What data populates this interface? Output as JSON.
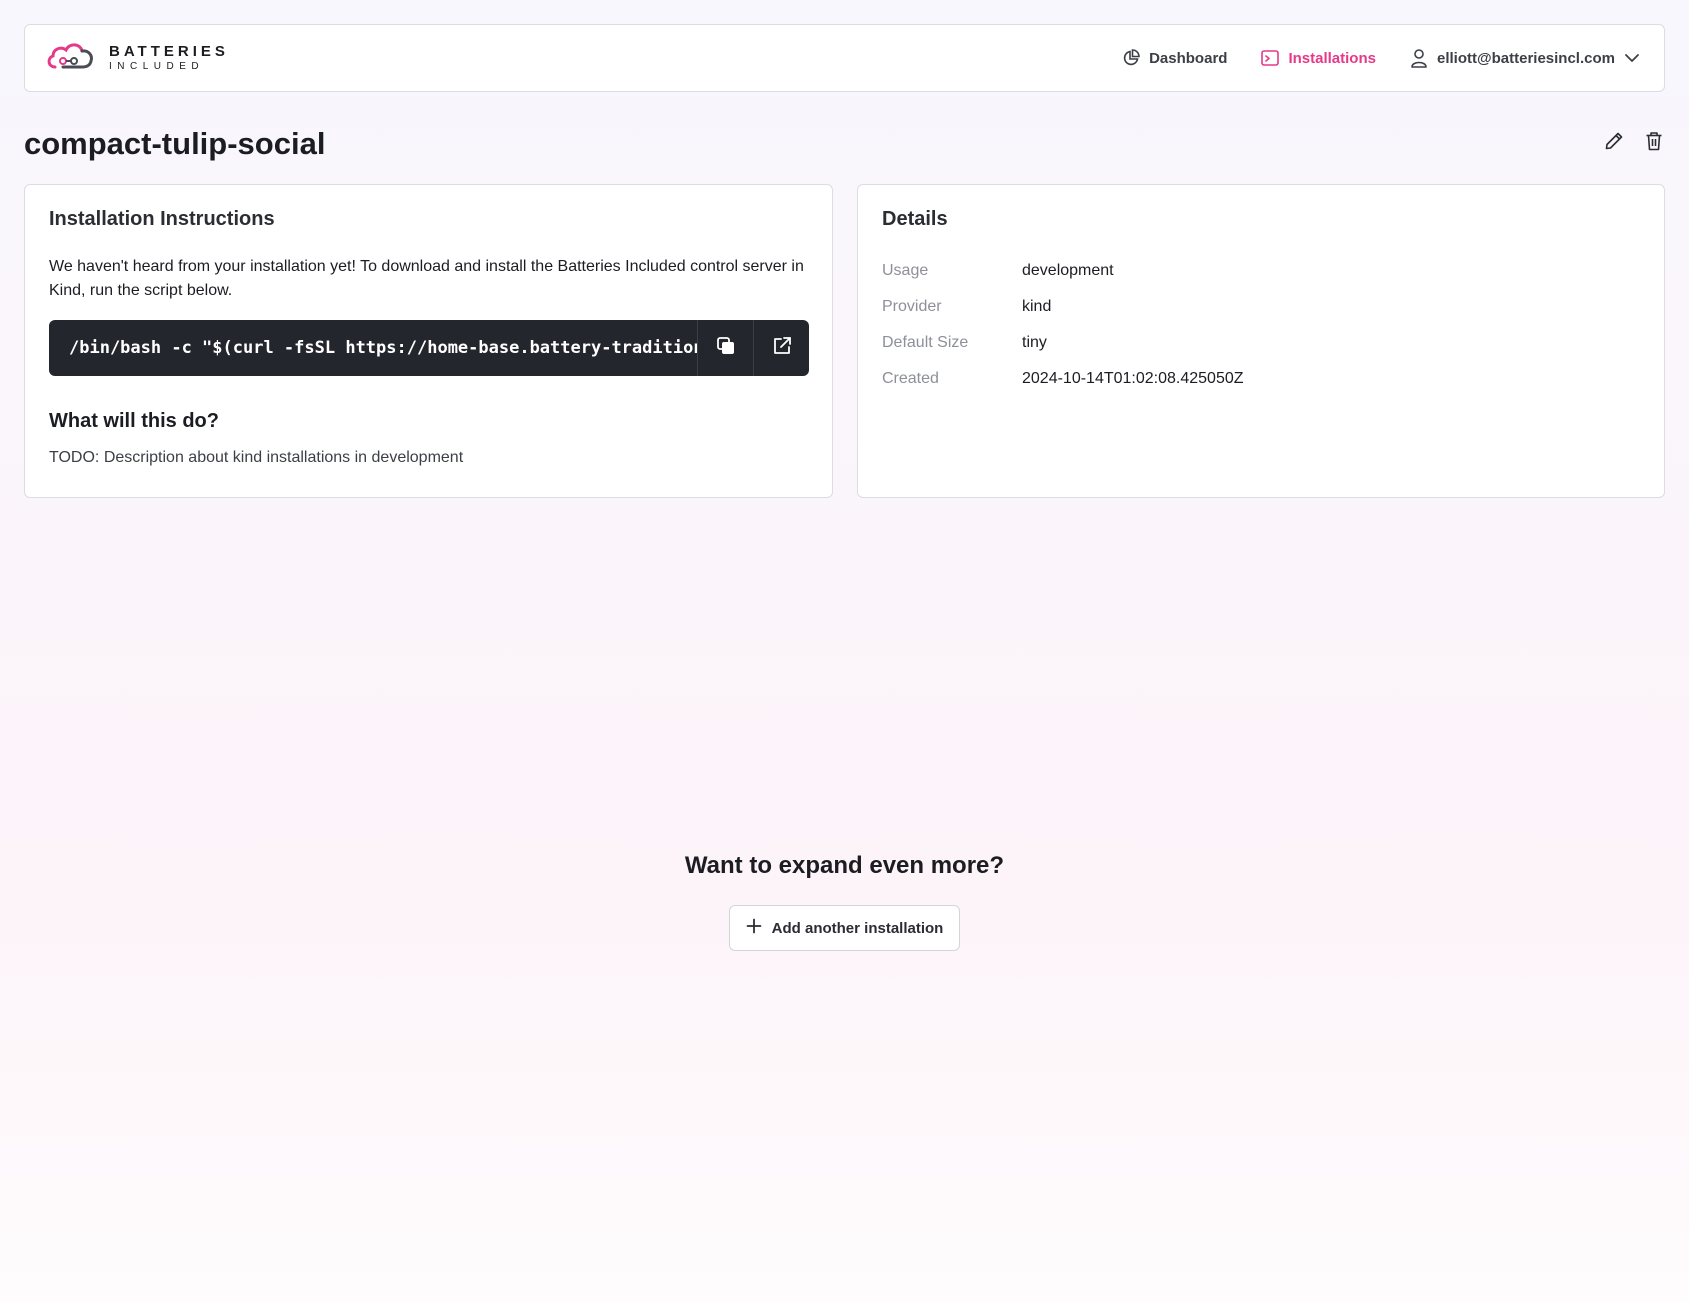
{
  "brand": {
    "line1": "BATTERIES",
    "line2": "INCLUDED",
    "accent": "#e6398a"
  },
  "nav": {
    "dashboard": "Dashboard",
    "installations": "Installations",
    "user_email": "elliott@batteriesincl.com"
  },
  "page": {
    "title": "compact-tulip-social"
  },
  "instructions": {
    "heading": "Installation Instructions",
    "intro": "We haven't heard from your installation yet! To download and install the Batteries Included control server in Kind, run the script below.",
    "command": "/bin/bash -c \"$(curl -fsSL https://home-base.battery-traditional",
    "question": "What will this do?",
    "description": "TODO: Description about kind installations in development"
  },
  "details": {
    "heading": "Details",
    "rows": [
      {
        "label": "Usage",
        "value": "development"
      },
      {
        "label": "Provider",
        "value": "kind"
      },
      {
        "label": "Default Size",
        "value": "tiny"
      },
      {
        "label": "Created",
        "value": "2024-10-14T01:02:08.425050Z"
      }
    ]
  },
  "expand": {
    "heading": "Want to expand even more?",
    "button_label": "Add another installation"
  }
}
